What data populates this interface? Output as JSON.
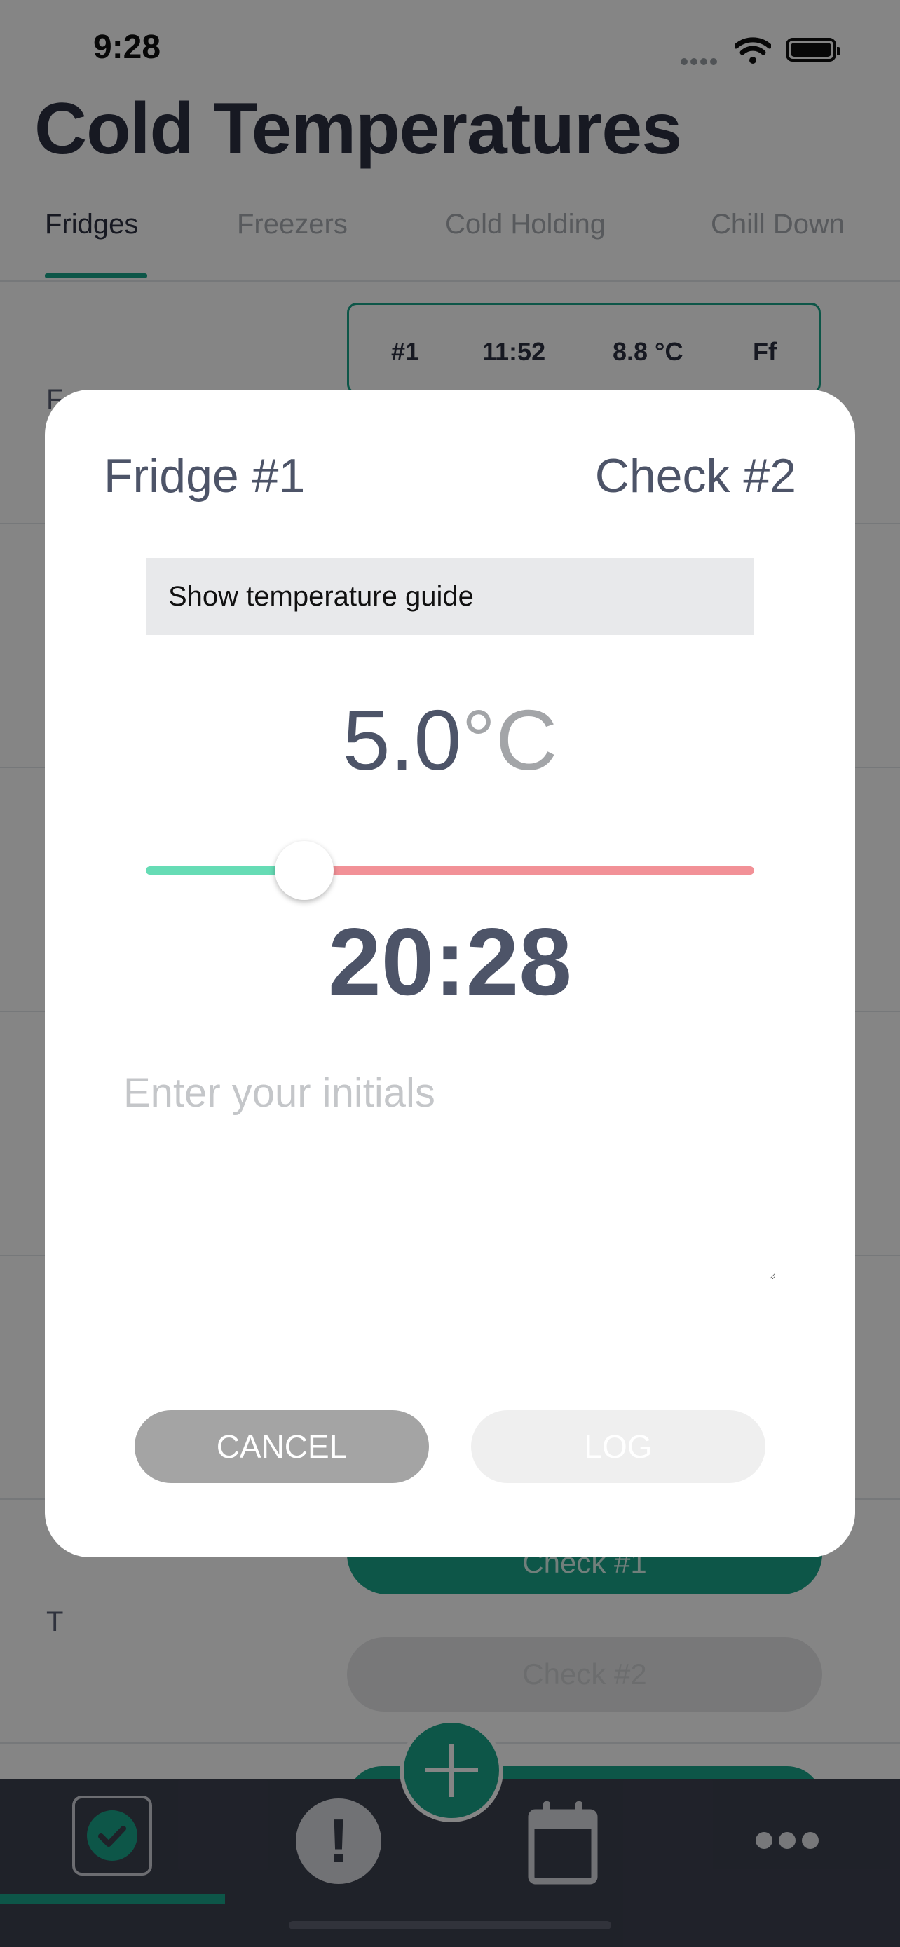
{
  "status_bar": {
    "time": "9:28"
  },
  "header": {
    "title": "Cold Temperatures"
  },
  "tabs": [
    {
      "label": "Fridges",
      "active": true
    },
    {
      "label": "Freezers",
      "active": false
    },
    {
      "label": "Cold Holding",
      "active": false
    },
    {
      "label": "Chill Down",
      "active": false
    }
  ],
  "background_list": {
    "rows": [
      {
        "letter": "F"
      },
      {
        "letter": "T"
      }
    ],
    "check_card": {
      "number": "#1",
      "time": "11:52",
      "temp": "8.8 °C",
      "initials": "Ff"
    },
    "check_buttons": [
      "Check #1",
      "Check #2"
    ]
  },
  "modal": {
    "fridge_label": "Fridge #1",
    "check_label": "Check #2",
    "guide_button": "Show temperature guide",
    "temperature": {
      "value": "5.0",
      "unit": "°C"
    },
    "slider_fraction": 0.26,
    "time": "20:28",
    "initials_placeholder": "Enter your initials",
    "initials_value": "",
    "cancel_label": "CANCEL",
    "log_label": "LOG"
  },
  "bottom_nav": {
    "items": [
      {
        "icon": "check-icon",
        "active": true
      },
      {
        "icon": "alert-icon",
        "glyph": "!",
        "active": false
      },
      {
        "icon": "calendar-icon",
        "active": false
      },
      {
        "icon": "more-icon",
        "active": false
      }
    ],
    "fab_icon": "plus-icon"
  },
  "colors": {
    "accent": "#1aa68a",
    "slider_low": "#66dcb5",
    "slider_high": "#f29197",
    "text_dark": "#4d5468",
    "nav_bg": "#3d4150"
  }
}
